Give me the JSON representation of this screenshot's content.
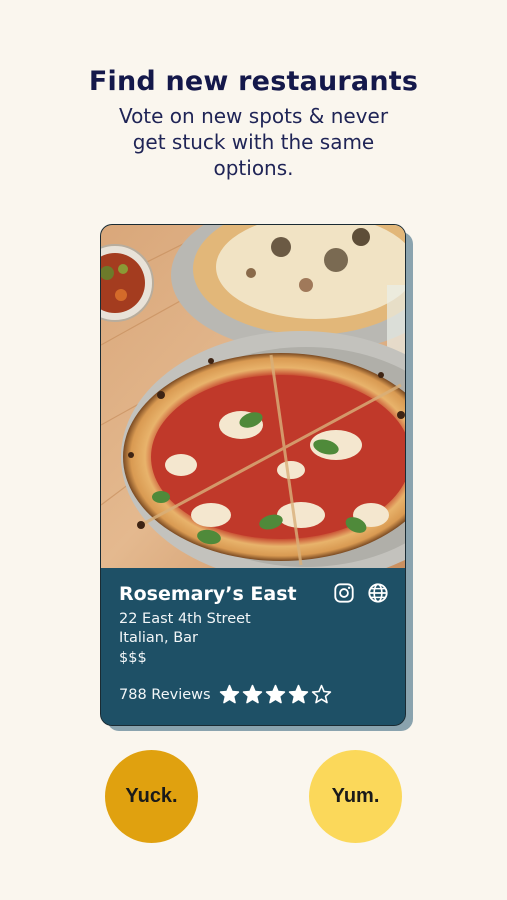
{
  "header": {
    "title": "Find new restaurants",
    "subtitle": "Vote on new spots & never get stuck with the same options."
  },
  "restaurant": {
    "name": "Rosemary’s East",
    "address": "22 East 4th Street",
    "categories": "Italian, Bar",
    "price": "$$$",
    "reviews": "788 Reviews",
    "rating": 4,
    "rating_max": 5,
    "photo_icon": "pizza-photo"
  },
  "actions": {
    "dislike_label": "Yuck.",
    "like_label": "Yum."
  },
  "colors": {
    "background": "#faf6ee",
    "title": "#14184a",
    "card": "#1e5066",
    "dislike": "#e0a10f",
    "like": "#fbd85a"
  }
}
